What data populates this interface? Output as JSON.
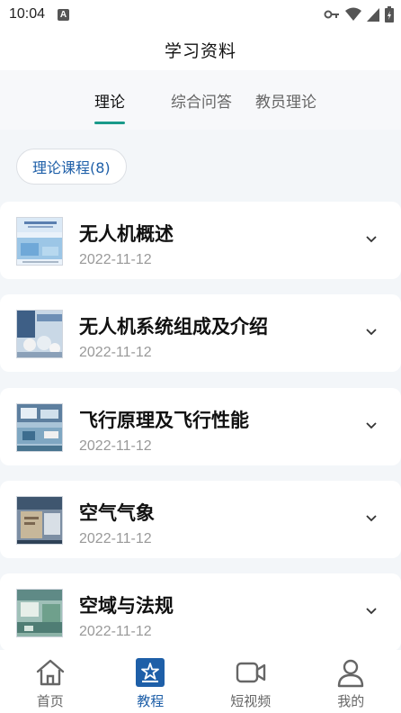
{
  "status_bar": {
    "time": "10:04",
    "notification_icon": "A"
  },
  "header": {
    "title": "学习资料"
  },
  "tabs": [
    {
      "label": "理论",
      "active": true
    },
    {
      "label": "综合问答",
      "active": false
    },
    {
      "label": "教员理论",
      "active": false
    }
  ],
  "filter_chip": {
    "label": "理论课程(8)"
  },
  "courses": [
    {
      "title": "无人机概述",
      "date": "2022-11-12",
      "thumb_color": "#7fb3d9"
    },
    {
      "title": "无人机系统组成及介绍",
      "date": "2022-11-12",
      "thumb_color": "#5b7fa5"
    },
    {
      "title": "飞行原理及飞行性能",
      "date": "2022-11-12",
      "thumb_color": "#6f8fb0"
    },
    {
      "title": "空气气象",
      "date": "2022-11-12",
      "thumb_color": "#8a9ab0"
    },
    {
      "title": "空域与法规",
      "date": "2022-11-12",
      "thumb_color": "#7aa6a0"
    }
  ],
  "bottom_nav": [
    {
      "label": "首页",
      "icon": "home-icon",
      "active": false
    },
    {
      "label": "教程",
      "icon": "tutorial-star-icon",
      "active": true
    },
    {
      "label": "短视频",
      "icon": "video-camera-icon",
      "active": false
    },
    {
      "label": "我的",
      "icon": "profile-icon",
      "active": false
    }
  ],
  "colors": {
    "accent": "#1a9a8a",
    "nav_active": "#1e5fa8",
    "chip_text": "#1e5fa8"
  }
}
